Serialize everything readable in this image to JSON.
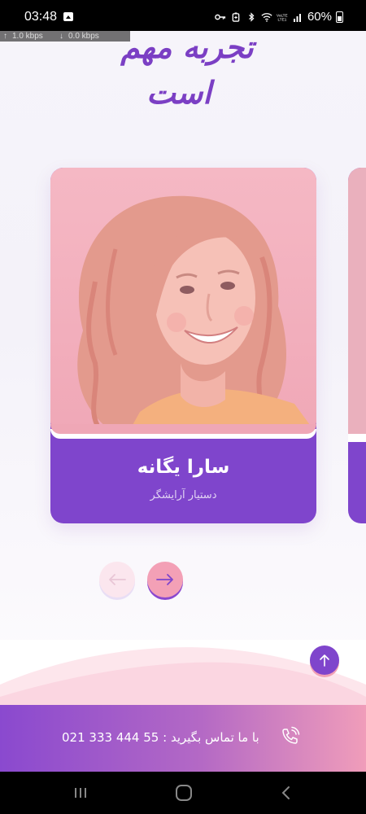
{
  "status_bar": {
    "time": "03:48",
    "battery": "60%",
    "net_up": "1.0 kbps",
    "net_down": "0.0 kbps",
    "icons": [
      "image-icon",
      "key-icon",
      "battery-saver-icon",
      "bluetooth-icon",
      "wifi-icon",
      "volte-icon",
      "signal-icon",
      "battery-icon"
    ]
  },
  "heading": {
    "line1": "تجربه مهم",
    "line2": "است"
  },
  "team": {
    "members": [
      {
        "name": "سارا یگانه",
        "role": "دستیار آرایشگر"
      }
    ]
  },
  "carousel": {
    "prev_icon": "arrow-left-icon",
    "next_icon": "arrow-right-icon"
  },
  "contact": {
    "text": "با ما تماس بگیرید : 55 444 333 021",
    "icon": "phone-ringing-icon"
  },
  "colors": {
    "brand_purple": "#7f45cc",
    "brand_pink": "#f3a0b6",
    "photo_overlay": "#f1a9b8"
  }
}
